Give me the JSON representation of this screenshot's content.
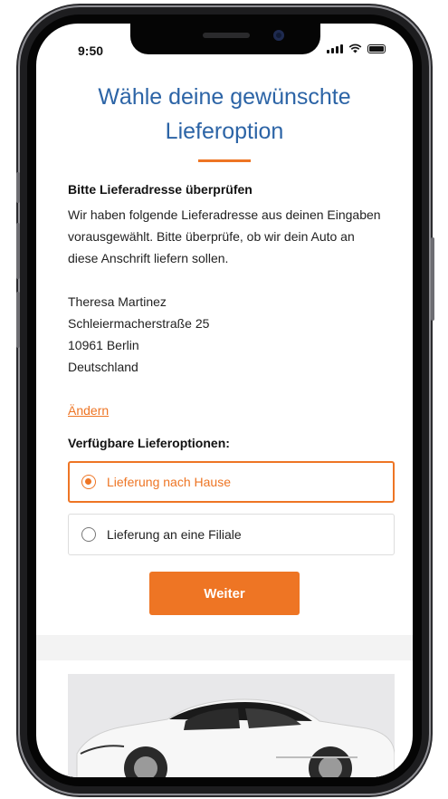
{
  "status_bar": {
    "time": "9:50"
  },
  "page": {
    "title": "Wähle deine gewünschte Lieferoption",
    "address_check_heading": "Bitte Lieferadresse überprüfen",
    "address_check_text": "Wir haben folgende Lieferadresse aus deinen Eingaben vorausgewählt. Bitte überprüfe, ob wir dein Auto an diese Anschrift liefern sollen.",
    "address": {
      "name": "Theresa Martinez",
      "street": "Schleiermacherstraße 25",
      "city": "10961 Berlin",
      "country": "Deutschland"
    },
    "change_link": "Ändern",
    "options_heading": "Verfügbare Lieferoptionen:",
    "options": [
      {
        "label": "Lieferung nach Hause",
        "selected": true
      },
      {
        "label": "Lieferung an eine Filiale",
        "selected": false
      }
    ],
    "continue_button": "Weiter"
  },
  "colors": {
    "accent": "#ee7524",
    "title_blue": "#2c64a6"
  }
}
